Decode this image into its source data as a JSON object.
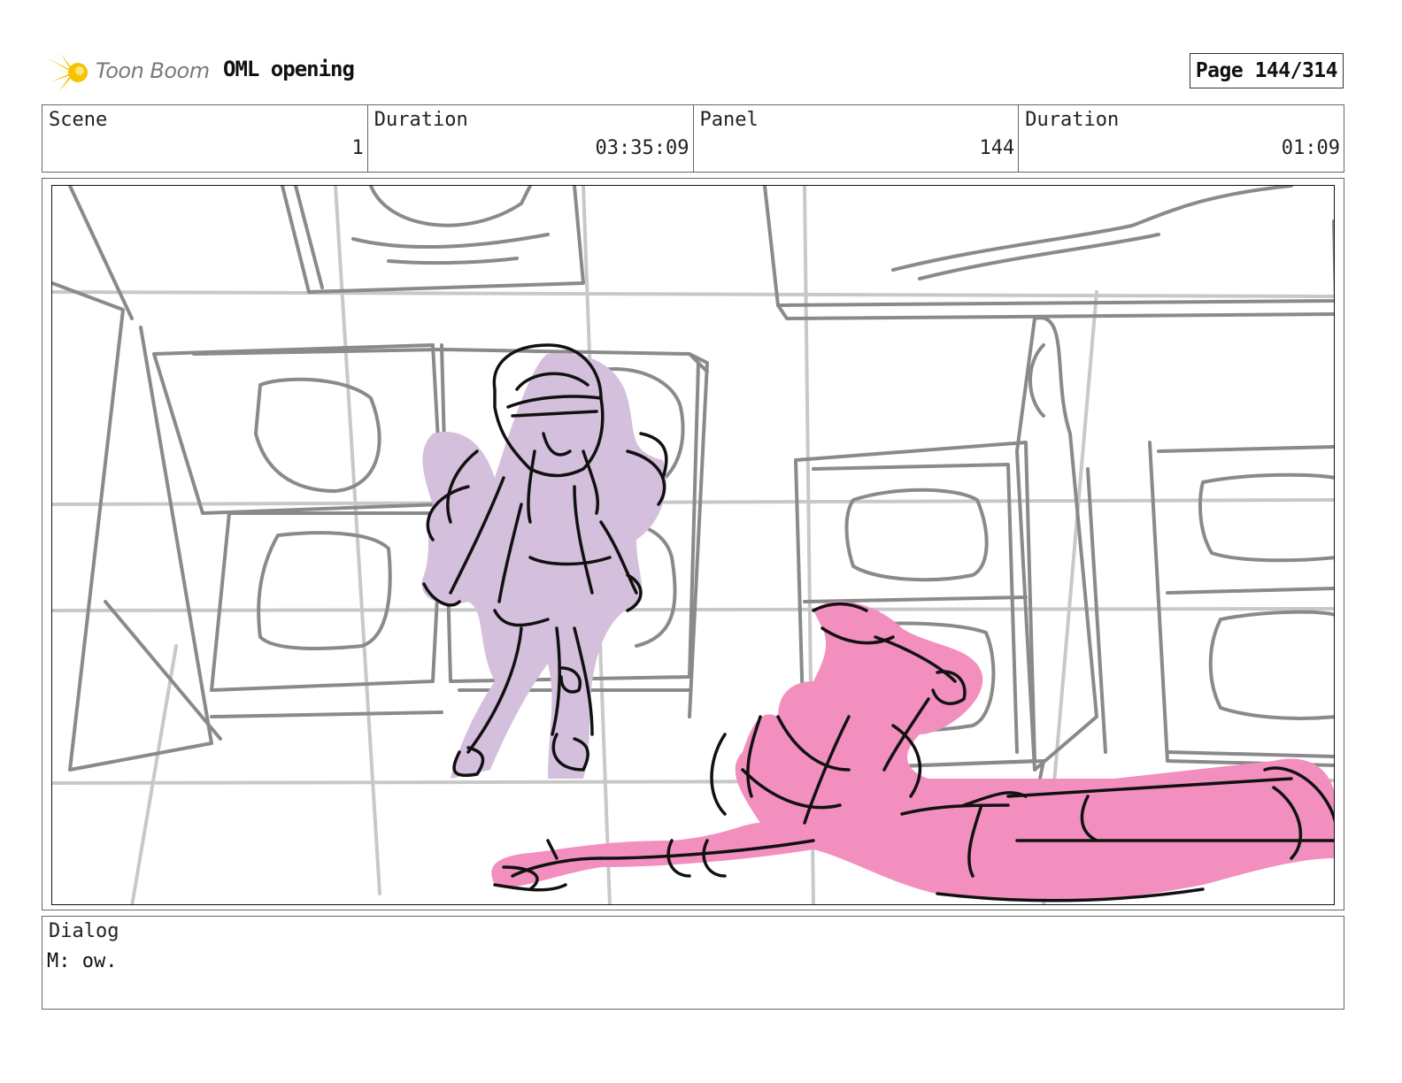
{
  "header": {
    "logo_text": "Toon Boom",
    "project_title": "OML opening",
    "page_label": "Page 144/314"
  },
  "info": {
    "scene_label": "Scene",
    "scene_value": "1",
    "duration_label": "Duration",
    "duration_value": "03:35:09",
    "panel_label": "Panel",
    "panel_value": "144",
    "panel_duration_label": "Duration",
    "panel_duration_value": "01:09"
  },
  "dialog": {
    "label": "Dialog",
    "text": "M: ow."
  },
  "colors": {
    "sketch_gray": "#8a8a8a",
    "character_lilac": "#d4bfdc",
    "character_pink": "#f28fbf",
    "ink": "#111111",
    "logo_yellow": "#f5c400"
  }
}
